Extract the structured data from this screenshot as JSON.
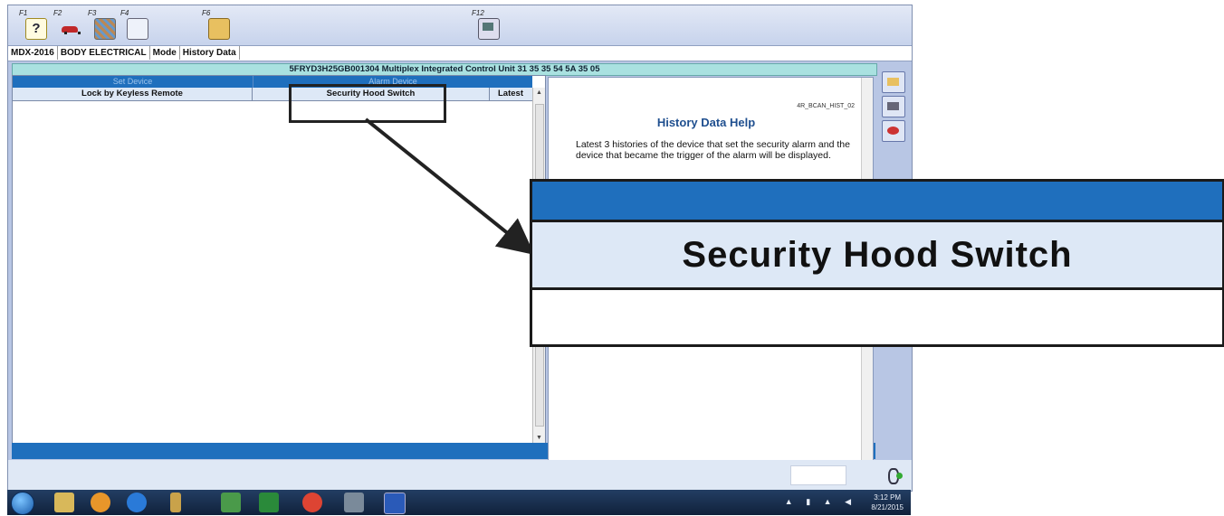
{
  "toolbar": {
    "keys": [
      {
        "label": "F1",
        "icon": "help-icon"
      },
      {
        "label": "F2",
        "icon": "car-icon"
      },
      {
        "label": "F3",
        "icon": "multiplex-icon"
      },
      {
        "label": "F4",
        "icon": "data-list-icon"
      },
      {
        "label": "F6",
        "icon": "folder-open-icon"
      },
      {
        "label": "F12",
        "icon": "computer-icon"
      }
    ]
  },
  "breadcrumb": [
    "MDX-2016",
    "BODY ELECTRICAL",
    "Mode",
    "History Data"
  ],
  "header": {
    "vin_line": "5FRYD3H25GB001304  Multiplex Integrated Control Unit  31 35 35 54 5A 35 05"
  },
  "table": {
    "group_set": "Set Device",
    "group_alarm": "Alarm Device",
    "columns": [
      "Lock by Keyless Remote",
      "Security Hood Switch",
      "Latest"
    ]
  },
  "help": {
    "code": "4R_BCAN_HIST_02",
    "title": "History Data Help",
    "body": "Latest 3 histories of the device that set the security alarm and the device that became the trigger of the alarm will be displayed."
  },
  "callout": {
    "label": "Security Hood Switch"
  },
  "taskbar": {
    "time": "3:12 PM",
    "date": "8/21/2015"
  },
  "colors": {
    "header_blue": "#1f6fbd",
    "column_bg": "#dde8f6",
    "vin_bar": "#a9e1e0"
  }
}
